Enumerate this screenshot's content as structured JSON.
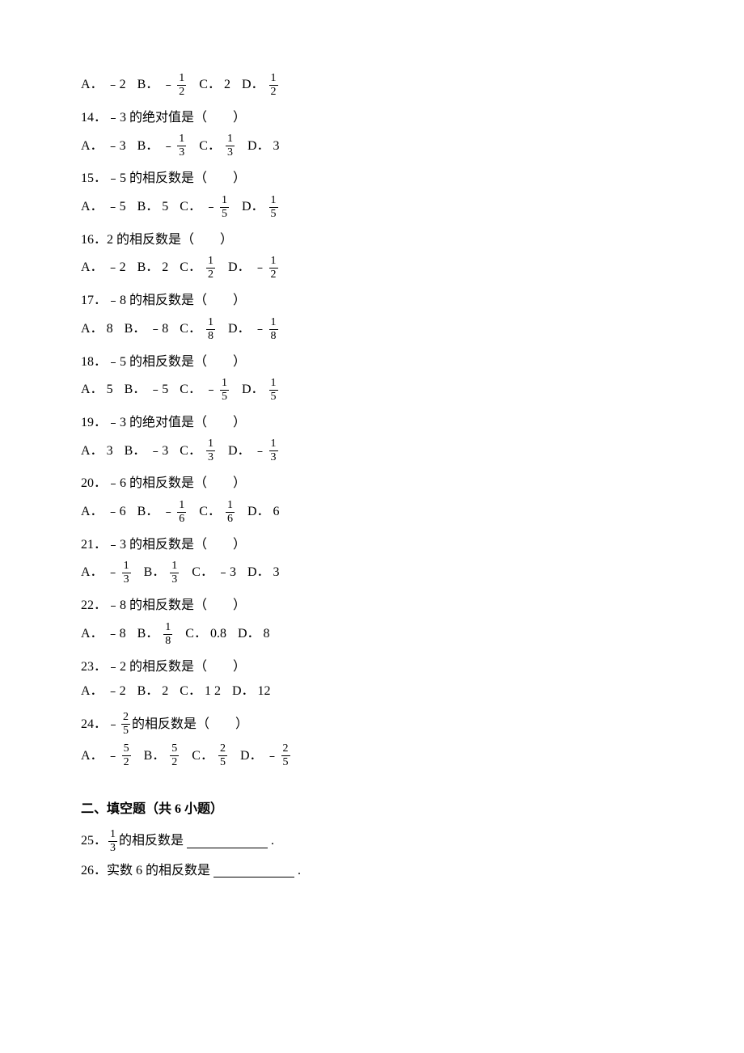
{
  "q13_options": {
    "a_label": "A．",
    "a_val": "﹣2",
    "b_label": "B．",
    "b_neg": "﹣",
    "b_num": "1",
    "b_den": "2",
    "c_label": "C．",
    "c_val": "2",
    "d_label": "D．",
    "d_num": "1",
    "d_den": "2"
  },
  "q14": {
    "text": "14．﹣3 的绝对值是（　　）",
    "a_label": "A．",
    "a_val": "﹣3",
    "b_label": "B．",
    "b_neg": "﹣",
    "b_num": "1",
    "b_den": "3",
    "c_label": "C．",
    "c_num": "1",
    "c_den": "3",
    "d_label": "D．",
    "d_val": "3"
  },
  "q15": {
    "text": "15．﹣5 的相反数是（　　）",
    "a_label": "A．",
    "a_val": "﹣5",
    "b_label": "B．",
    "b_val": "5",
    "c_label": "C．",
    "c_neg": "﹣",
    "c_num": "1",
    "c_den": "5",
    "d_label": "D．",
    "d_num": "1",
    "d_den": "5"
  },
  "q16": {
    "text": "16．2 的相反数是（　　）",
    "a_label": "A．",
    "a_val": "﹣2",
    "b_label": "B．",
    "b_val": "2",
    "c_label": "C．",
    "c_num": "1",
    "c_den": "2",
    "d_label": "D．",
    "d_neg": "﹣",
    "d_num": "1",
    "d_den": "2"
  },
  "q17": {
    "text": "17．﹣8 的相反数是（　　）",
    "a_label": "A．",
    "a_val": "8",
    "b_label": "B．",
    "b_val": "﹣8",
    "c_label": "C．",
    "c_num": "1",
    "c_den": "8",
    "d_label": "D．",
    "d_neg": "﹣",
    "d_num": "1",
    "d_den": "8"
  },
  "q18": {
    "text": "18．﹣5 的相反数是（　　）",
    "a_label": "A．",
    "a_val": "5",
    "b_label": "B．",
    "b_val": "﹣5",
    "c_label": "C．",
    "c_neg": "﹣",
    "c_num": "1",
    "c_den": "5",
    "d_label": "D．",
    "d_num": "1",
    "d_den": "5"
  },
  "q19": {
    "text": "19．﹣3 的绝对值是（　　）",
    "a_label": "A．",
    "a_val": "3",
    "b_label": "B．",
    "b_val": "﹣3",
    "c_label": "C．",
    "c_num": "1",
    "c_den": "3",
    "d_label": "D．",
    "d_neg": "﹣",
    "d_num": "1",
    "d_den": "3"
  },
  "q20": {
    "text": "20．﹣6 的相反数是（　　）",
    "a_label": "A．",
    "a_val": "﹣6",
    "b_label": "B．",
    "b_neg": "﹣",
    "b_num": "1",
    "b_den": "6",
    "c_label": "C．",
    "c_num": "1",
    "c_den": "6",
    "d_label": "D．",
    "d_val": "6"
  },
  "q21": {
    "text": "21．﹣3 的相反数是（　　）",
    "a_label": "A．",
    "a_neg": "﹣",
    "a_num": "1",
    "a_den": "3",
    "b_label": "B．",
    "b_num": "1",
    "b_den": "3",
    "c_label": "C．",
    "c_val": "﹣3",
    "d_label": "D．",
    "d_val": "3"
  },
  "q22": {
    "text": "22．﹣8 的相反数是（　　）",
    "a_label": "A．",
    "a_val": "﹣8",
    "b_label": "B．",
    "b_num": "1",
    "b_den": "8",
    "c_label": "C．",
    "c_val": "0.8",
    "d_label": "D．",
    "d_val": "8"
  },
  "q23": {
    "text": "23．﹣2 的相反数是（　　）",
    "a_label": "A．",
    "a_val": "﹣2",
    "b_label": "B．",
    "b_val": "2",
    "c_label": "C．",
    "c_val": "1 2",
    "d_label": "D．",
    "d_val": "12"
  },
  "q24": {
    "text_pre": "24．﹣",
    "text_num": "2",
    "text_den": "5",
    "text_post": "的相反数是（　　）",
    "a_label": "A．",
    "a_neg": "﹣",
    "a_num": "5",
    "a_den": "2",
    "b_label": "B．",
    "b_num": "5",
    "b_den": "2",
    "c_label": "C．",
    "c_num": "2",
    "c_den": "5",
    "d_label": "D．",
    "d_neg": "﹣",
    "d_num": "2",
    "d_den": "5"
  },
  "section2": {
    "title": "二、填空题（共 6 小题）"
  },
  "q25": {
    "text_pre": "25．",
    "text_num": "1",
    "text_den": "3",
    "text_post": "的相反数是",
    "period": "."
  },
  "q26": {
    "text_pre": "26．实数 6 的相反数是",
    "period": "."
  }
}
